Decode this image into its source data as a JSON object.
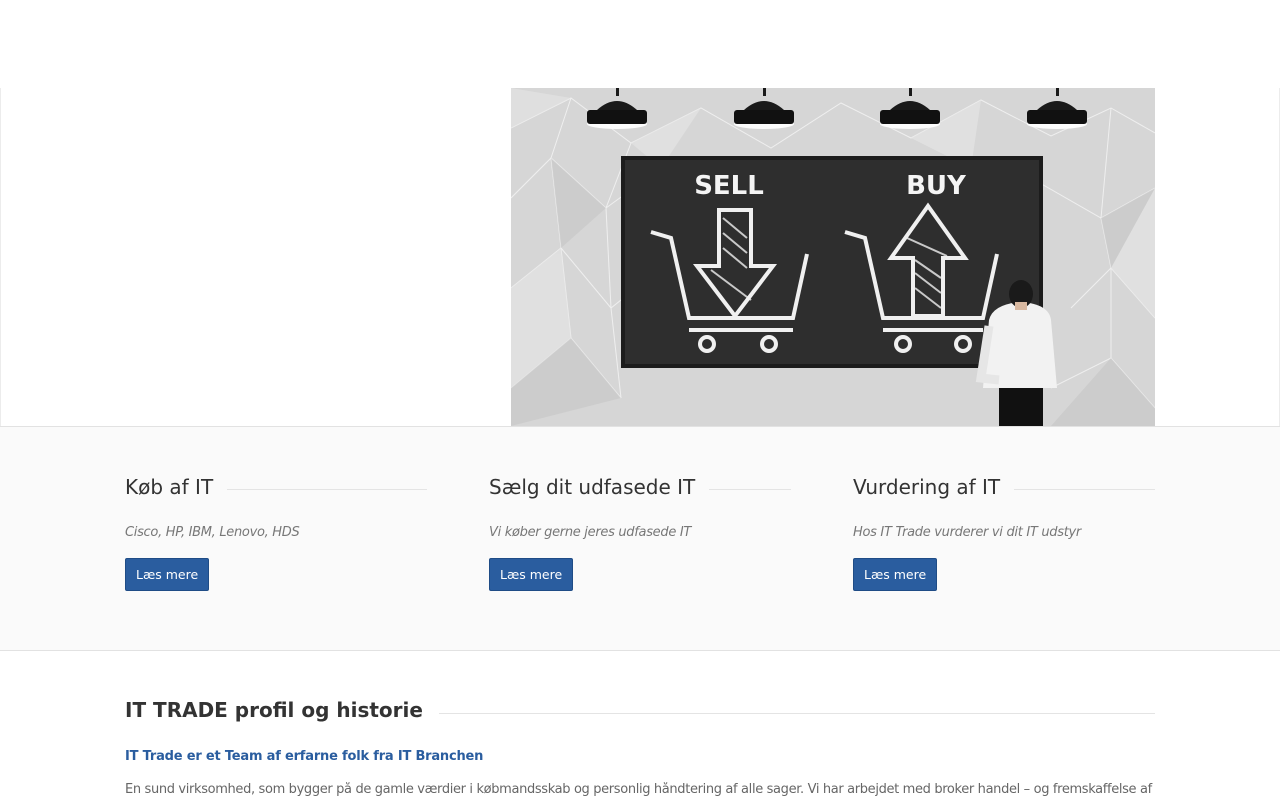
{
  "hero": {
    "image_labels": {
      "sell": "SELL",
      "buy": "BUY"
    }
  },
  "features": [
    {
      "title": "Køb af IT",
      "subtitle": "Cisco, HP, IBM, Lenovo, HDS",
      "button": "Læs mere"
    },
    {
      "title": "Sælg dit udfasede IT",
      "subtitle": "Vi køber gerne jeres udfasede IT",
      "button": "Læs mere"
    },
    {
      "title": "Vurdering af IT",
      "subtitle": "Hos IT Trade vurderer vi dit IT udstyr",
      "button": "Læs mere"
    }
  ],
  "profile": {
    "title": "IT TRADE profil og historie",
    "lead": "IT Trade er et Team af erfarne folk fra IT Branchen",
    "text": "En sund virksomhed, som bygger på de gamle værdier i købmandsskab og personlig håndtering af alle sager. Vi har arbejdet med broker handel – og fremskaffelse af varer"
  },
  "colors": {
    "accent": "#2a5d9f",
    "section_bg": "#fafafa",
    "chalkboard": "#2e2e2e"
  }
}
